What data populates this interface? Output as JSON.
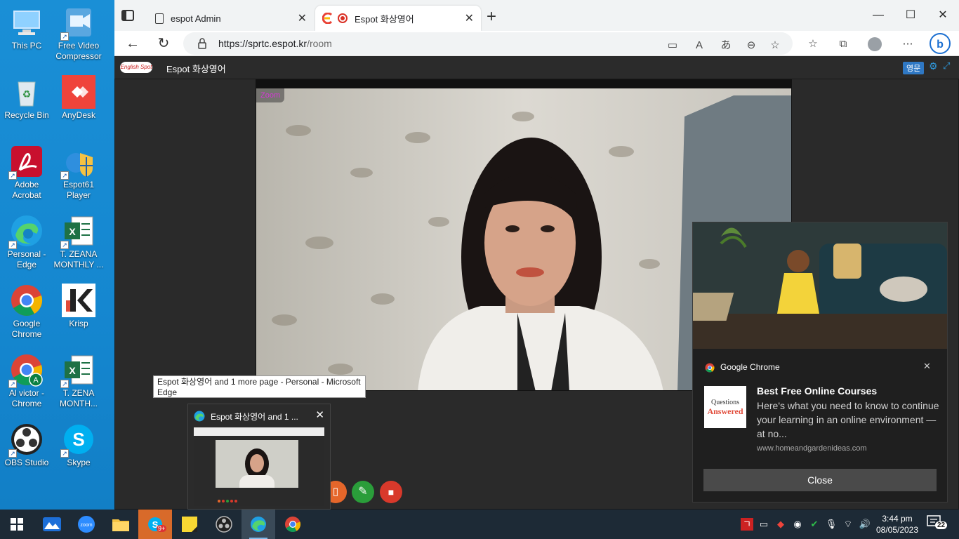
{
  "desktop": {
    "icons": [
      {
        "label": "This PC",
        "icon": "monitor-icon"
      },
      {
        "label": "Free Video Compressor",
        "icon": "film-icon"
      },
      {
        "label": "Recycle Bin",
        "icon": "recycle-bin-icon"
      },
      {
        "label": "AnyDesk",
        "icon": "anydesk-icon"
      },
      {
        "label": "Adobe Acrobat",
        "icon": "pdf-icon"
      },
      {
        "label": "Espot61 Player",
        "icon": "player-icon"
      },
      {
        "label": "Personal - Edge",
        "icon": "edge-icon"
      },
      {
        "label": "T. ZEANA MONTHLY ...",
        "icon": "excel-icon"
      },
      {
        "label": "Google Chrome",
        "icon": "chrome-icon"
      },
      {
        "label": "Krisp",
        "icon": "krisp-icon"
      },
      {
        "label": "Al victor - Chrome",
        "icon": "chrome-profile-icon"
      },
      {
        "label": "T. ZENA MONTH...",
        "icon": "excel-icon"
      },
      {
        "label": "OBS Studio",
        "icon": "obs-icon"
      },
      {
        "label": "Skype",
        "icon": "skype-icon"
      }
    ]
  },
  "browser": {
    "tabs": [
      {
        "title": "espot Admin",
        "active": false
      },
      {
        "title": "Espot 화상영어",
        "active": true
      }
    ],
    "new_tab": "+",
    "window_controls": {
      "minimize": "—",
      "maximize": "☐",
      "close": "✕"
    },
    "url_host": "https://sprtc.espot.kr",
    "url_path": "/room"
  },
  "app": {
    "logo_text": "English Spot",
    "title": "Espot 화상영어",
    "lang_button": "영문",
    "video_label": "Zoom"
  },
  "tooltip": {
    "text": "Espot 화상영어 and 1 more page - Personal - Microsoft Edge"
  },
  "thumbnail": {
    "title": "Espot 화상영어 and 1 ..."
  },
  "notification": {
    "app": "Google Chrome",
    "title": "Best Free Online Courses",
    "body": "Here's what you need to know to continue your learning in an online environment — at no...",
    "source": "www.homeandgardenideas.com",
    "logo_line1": "Questions",
    "logo_line2": "Answered",
    "close_button": "Close"
  },
  "taskbar": {
    "skype_badge": "9+",
    "time": "3:44 pm",
    "date": "08/05/2023",
    "notification_count": "22",
    "colors": {
      "bg": "#1d2a36",
      "active": "#3a4a58"
    }
  }
}
